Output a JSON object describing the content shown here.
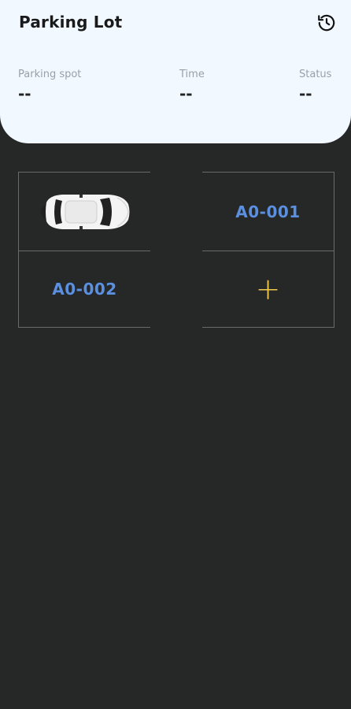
{
  "header": {
    "title": "Parking Lot",
    "history_icon": "history-icon"
  },
  "info": {
    "spot_label": "Parking spot",
    "spot_value": "--",
    "time_label": "Time",
    "time_value": "--",
    "status_label": "Status",
    "status_value": "--"
  },
  "slots": [
    {
      "type": "car"
    },
    {
      "type": "code",
      "code": "A0-001"
    },
    {
      "type": "code",
      "code": "A0-002"
    },
    {
      "type": "add",
      "symbol": "+"
    }
  ],
  "colors": {
    "background": "#262727",
    "header_card": "#f2f8ff",
    "slot_code": "#5b8fe0",
    "add_symbol": "#f2c84b"
  }
}
